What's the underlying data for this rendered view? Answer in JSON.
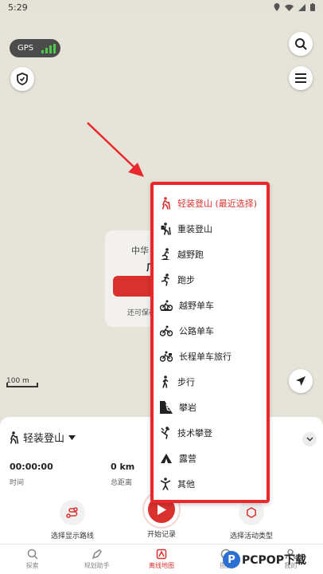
{
  "status_bar": {
    "time": "5:29"
  },
  "map": {
    "gps_label": "GPS",
    "scale_label": "100 m",
    "card": {
      "line1": "中华",
      "line2": "广",
      "footer": "还可保存"
    }
  },
  "bottom_sheet": {
    "activity_label": "轻装登山",
    "stats": [
      {
        "value": "00:00:00",
        "label": "时间"
      },
      {
        "value": "0 km",
        "label": "总距离"
      }
    ],
    "actions": {
      "route": "选择显示路线",
      "start": "开始记录",
      "activity_type": "选择活动类型"
    }
  },
  "activity_menu": {
    "items": [
      {
        "label": "轻装登山 (最近选择)",
        "icon": "hiker-icon"
      },
      {
        "label": "重装登山",
        "icon": "heavy-hiker-icon"
      },
      {
        "label": "越野跑",
        "icon": "trail-run-icon"
      },
      {
        "label": "跑步",
        "icon": "run-icon"
      },
      {
        "label": "越野单车",
        "icon": "mtb-icon"
      },
      {
        "label": "公路单车",
        "icon": "road-bike-icon"
      },
      {
        "label": "长程单车旅行",
        "icon": "touring-bike-icon"
      },
      {
        "label": "步行",
        "icon": "walk-icon"
      },
      {
        "label": "攀岩",
        "icon": "climb-icon"
      },
      {
        "label": "技术攀登",
        "icon": "tech-climb-icon"
      },
      {
        "label": "露营",
        "icon": "tent-icon"
      },
      {
        "label": "其他",
        "icon": "other-icon"
      }
    ]
  },
  "bottom_nav": {
    "items": [
      {
        "label": "探索"
      },
      {
        "label": "规划助手"
      },
      {
        "label": "离线地图"
      },
      {
        "label": "攒圈"
      },
      {
        "label": "我的"
      }
    ]
  },
  "watermark": {
    "text": "PCPOP下载"
  },
  "colors": {
    "accent": "#d9322e",
    "highlight": "#e8282a",
    "gps_green": "#4fc84a"
  }
}
